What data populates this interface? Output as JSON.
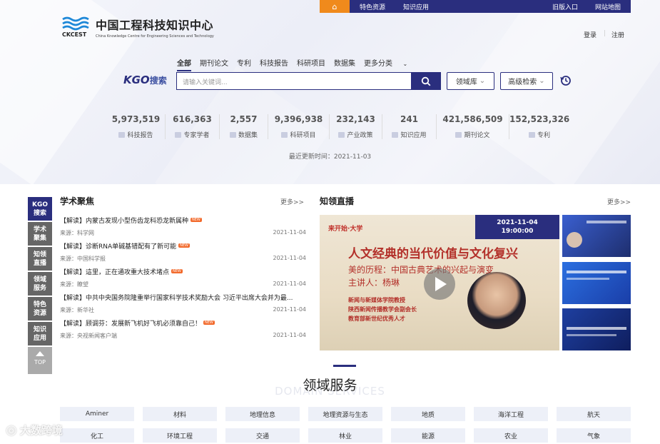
{
  "colors": {
    "brand": "#2a2e7e",
    "accent": "#f08a1c",
    "badge": "#f26a2c"
  },
  "topbar": {
    "home_icon": "home-icon",
    "links": [
      "特色资源",
      "知识应用",
      "旧版入口",
      "网站地图"
    ]
  },
  "logo": {
    "cn": "中国工程科技知识中心",
    "en": "China Knowledge Centre for Engineering Sciences and Technology",
    "abbr": "CKCEST"
  },
  "auth": {
    "login": "登录",
    "register": "注册"
  },
  "search": {
    "tabs": [
      "全部",
      "期刊论文",
      "专利",
      "科技报告",
      "科研项目",
      "数据集",
      "更多分类"
    ],
    "active_tab": "全部",
    "brand": "KGO",
    "brand_cn": "搜索",
    "placeholder": "请输入关键词...",
    "domain_select": "领域库",
    "advanced": "高级检索"
  },
  "stats": [
    {
      "num": "5,973,519",
      "label": "科技报告"
    },
    {
      "num": "616,363",
      "label": "专家学者"
    },
    {
      "num": "2,557",
      "label": "数据集"
    },
    {
      "num": "9,396,938",
      "label": "科研项目"
    },
    {
      "num": "232,143",
      "label": "产业政策"
    },
    {
      "num": "241",
      "label": "知识应用"
    },
    {
      "num": "421,586,509",
      "label": "期刊论文"
    },
    {
      "num": "152,523,326",
      "label": "专利"
    }
  ],
  "updated": "最近更新时间：2021-11-03",
  "sidenav": [
    "KGO搜索",
    "学术聚集",
    "知领直播",
    "领域服务",
    "特色资源",
    "知识应用"
  ],
  "sidenav_top": "TOP",
  "academic": {
    "title": "学术聚焦",
    "more": "更多>>",
    "badge": "NEW",
    "items": [
      {
        "title": "【解读】内蒙古发现小型伤齿龙科恐龙新属种",
        "source": "来源：科学网",
        "date": "2021-11-04"
      },
      {
        "title": "【解读】诊断RNA单碱基错配有了新可能",
        "source": "来源：中国科学报",
        "date": "2021-11-04"
      },
      {
        "title": "【解读】這里，正在通攻重大技术堵点",
        "source": "来源：瞭望",
        "date": "2021-11-04"
      },
      {
        "title": "【解读】中共中央国务院隆重举行国家科学技术奖励大会 习近平出席大会并为最...",
        "source": "来源：新华社",
        "date": "2021-11-04"
      },
      {
        "title": "【解读】顾调芬：发展新飞机好飞机必须靠自己！",
        "source": "来源：央视新闻客户端",
        "date": "2021-11-04"
      }
    ]
  },
  "live": {
    "title": "知领直播",
    "more": "更多>>",
    "date": "2021-11-04",
    "time": "19:00:00",
    "org": "来开始·大学",
    "headline": "人文经典的当代价值与文化复兴",
    "subtitle": "美的历程：中国古典艺术的兴起与演变",
    "speaker": "主讲人：杨琳",
    "desc": [
      "新闻与新媒体学院教授",
      "陕西新闻传播教学会副会长",
      "教育部新世纪优秀人才"
    ]
  },
  "domain": {
    "title": "领域服务",
    "subtitle": "DOMAIN SERVICES",
    "tiles_row1": [
      "Aminer",
      "材料",
      "地理信息",
      "地理资源与生态",
      "地质",
      "海洋工程",
      "航天"
    ],
    "tiles_row2": [
      "化工",
      "环境工程",
      "交通",
      "林业",
      "能源",
      "农业",
      "气象"
    ]
  },
  "watermark": "大数跨境"
}
